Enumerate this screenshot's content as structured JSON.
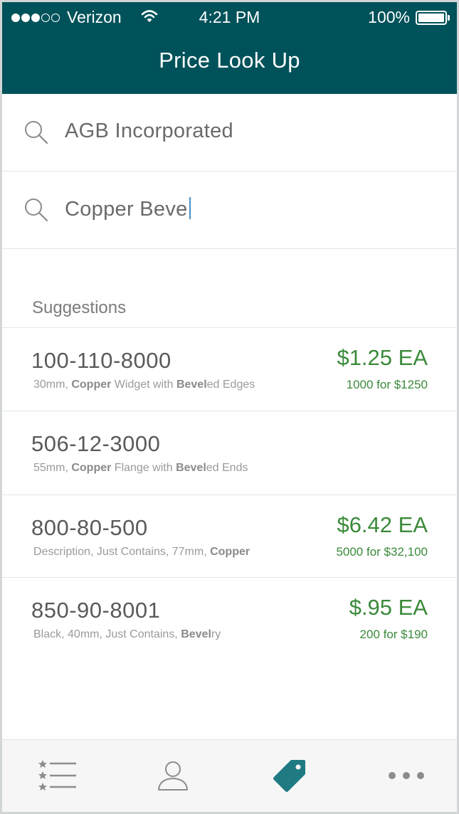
{
  "status_bar": {
    "carrier": "Verizon",
    "time": "4:21 PM",
    "battery": "100%",
    "signal_bars_on": 3,
    "signal_bars_total": 5
  },
  "header": {
    "title": "Price Look Up"
  },
  "search": {
    "customer_value": "AGB Incorporated",
    "product_value": "Copper Beve"
  },
  "suggestions": {
    "label": "Suggestions",
    "items": [
      {
        "part_number": "100-110-8000",
        "desc_parts": [
          {
            "t": "30mm, ",
            "b": false
          },
          {
            "t": "Copper",
            "b": true
          },
          {
            "t": " Widget with ",
            "b": false
          },
          {
            "t": "Bevel",
            "b": true
          },
          {
            "t": "ed Edges",
            "b": false
          }
        ],
        "price": "$1.25 EA",
        "qty_price": "1000 for $1250"
      },
      {
        "part_number": "506-12-3000",
        "desc_parts": [
          {
            "t": "55mm, ",
            "b": false
          },
          {
            "t": "Copper",
            "b": true
          },
          {
            "t": " Flange with ",
            "b": false
          },
          {
            "t": "Bevel",
            "b": true
          },
          {
            "t": "ed Ends",
            "b": false
          }
        ],
        "price": "",
        "qty_price": ""
      },
      {
        "part_number": "800-80-500",
        "desc_parts": [
          {
            "t": "Description, Just Contains, 77mm, ",
            "b": false
          },
          {
            "t": "Copper",
            "b": true
          }
        ],
        "price": "$6.42 EA",
        "qty_price": "5000 for $32,100"
      },
      {
        "part_number": "850-90-8001",
        "desc_parts": [
          {
            "t": "Black",
            "b": false
          },
          {
            "t": ", 40mm, Just Contains, ",
            "b": false
          },
          {
            "t": "Bevel",
            "b": true
          },
          {
            "t": "ry",
            "b": false
          }
        ],
        "price": "$.95 EA",
        "qty_price": "200 for $190"
      }
    ]
  },
  "tab_bar": {
    "tabs": [
      {
        "icon": "starred-list-icon",
        "active": false
      },
      {
        "icon": "person-icon",
        "active": false
      },
      {
        "icon": "price-tag-icon",
        "active": true
      },
      {
        "icon": "more-dots-icon",
        "active": false
      }
    ],
    "active_color": "#1f7a82",
    "inactive_color": "#8c8c8c"
  },
  "colors": {
    "header_bg": "#00525a",
    "price_green": "#3a8a3a"
  }
}
